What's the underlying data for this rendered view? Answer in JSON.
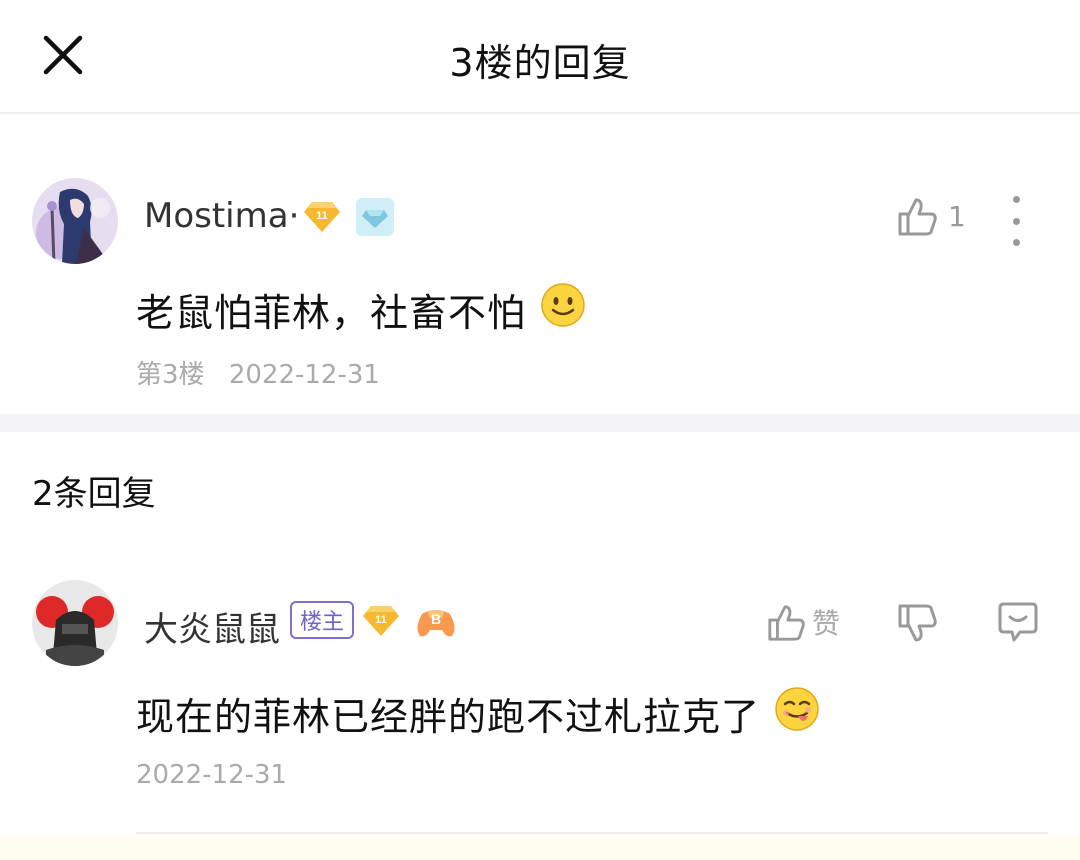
{
  "header": {
    "title": "3楼的回复"
  },
  "main_comment": {
    "username": "Mostima·",
    "level": "11",
    "likes": "1",
    "text": "老鼠怕菲林，社畜不怕",
    "floor": "第3楼",
    "date": "2022-12-31"
  },
  "replies": {
    "count_label": "2条回复",
    "items": [
      {
        "username": "大炎鼠鼠",
        "host_tag": "楼主",
        "level": "11",
        "like_label": "赞",
        "text": "现在的菲林已经胖的跑不过札拉克了",
        "date": "2022-12-31"
      }
    ]
  },
  "colors": {
    "level_badge": "#f5b82e",
    "host_tag": "#7b6fd6",
    "muted": "#aaaaaa"
  }
}
